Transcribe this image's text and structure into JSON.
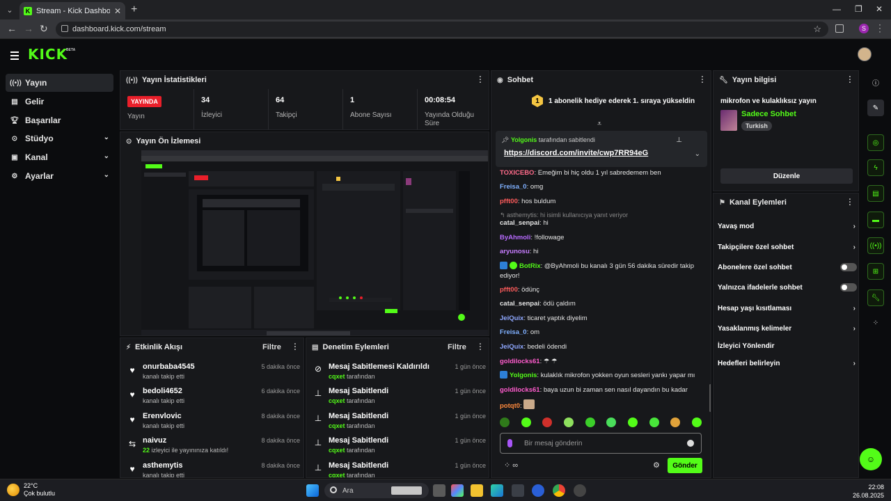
{
  "browser": {
    "tab_title": "Stream - Kick Dashboard",
    "url": "dashboard.kick.com/stream",
    "profile_initial": "S"
  },
  "brand": {
    "logo": "KICK",
    "beta": "BETA",
    "accent": "#53fc18"
  },
  "sidebar": {
    "items": [
      {
        "label": "Yayın",
        "icon": "broadcast-icon",
        "active": true
      },
      {
        "label": "Gelir",
        "icon": "revenue-icon"
      },
      {
        "label": "Başarılar",
        "icon": "trophy-icon"
      },
      {
        "label": "Stüdyo",
        "icon": "studio-icon",
        "expandable": true
      },
      {
        "label": "Kanal",
        "icon": "channel-icon",
        "expandable": true
      },
      {
        "label": "Ayarlar",
        "icon": "gear-icon",
        "expandable": true
      }
    ]
  },
  "stats": {
    "title": "Yayın İstatistikleri",
    "live_badge": "YAYINDA",
    "live_label": "Yayın",
    "items": [
      {
        "value": "34",
        "label": "İzleyici"
      },
      {
        "value": "64",
        "label": "Takipçi"
      },
      {
        "value": "1",
        "label": "Abone Sayısı"
      },
      {
        "value": "00:08:54",
        "label": "Yayında Olduğu Süre"
      }
    ]
  },
  "preview": {
    "title": "Yayın Ön İzlemesi"
  },
  "activity": {
    "title": "Etkinlik Akışı",
    "filter": "Filtre",
    "rows": [
      {
        "name": "onurbaba4545",
        "sub": "kanalı takip etti",
        "time": "5 dakika önce",
        "icon": "heart-icon"
      },
      {
        "name": "bedoli4652",
        "sub": "kanalı takip etti",
        "time": "6 dakika önce",
        "icon": "heart-icon"
      },
      {
        "name": "Erenvlovic",
        "sub": "kanalı takip etti",
        "time": "8 dakika önce",
        "icon": "heart-icon"
      },
      {
        "name": "naivuz",
        "sub_count": "22",
        "sub": "izleyici ile yayınınıza katıldı!",
        "time": "8 dakika önce",
        "icon": "raid-icon"
      },
      {
        "name": "asthemytis",
        "sub": "kanalı takip etti",
        "time": "8 dakika önce",
        "icon": "heart-icon"
      }
    ]
  },
  "moderation": {
    "title": "Denetim Eylemleri",
    "filter": "Filtre",
    "rows": [
      {
        "action": "Mesaj Sabitlemesi Kaldırıldı",
        "by": "cqxet",
        "by_suffix": "tarafından",
        "time": "1 gün önce",
        "icon": "unpin-icon"
      },
      {
        "action": "Mesaj Sabitlendi",
        "by": "cqxet",
        "by_suffix": "tarafından",
        "time": "1 gün önce",
        "icon": "pin-icon"
      },
      {
        "action": "Mesaj Sabitlendi",
        "by": "cqxet",
        "by_suffix": "tarafından",
        "time": "1 gün önce",
        "icon": "pin-icon"
      },
      {
        "action": "Mesaj Sabitlendi",
        "by": "cqxet",
        "by_suffix": "tarafından",
        "time": "1 gün önce",
        "icon": "pin-icon"
      },
      {
        "action": "Mesaj Sabitlendi",
        "by": "cqxet",
        "by_suffix": "tarafından",
        "time": "1 gün önce",
        "icon": "pin-icon"
      }
    ]
  },
  "chat": {
    "title": "Sohbet",
    "gift_rank": "1",
    "gift_text": "1 abonelik hediye ederek 1. sıraya yükseldin",
    "pinned": {
      "by": "Yolgonis",
      "by_suffix": "tarafından sabitlendi",
      "link": "https://discord.com/invite/cwp7RR94eG"
    },
    "messages": [
      {
        "user": "TOXICEBO",
        "color": "#ff6b8a",
        "text": "Emeğim bi hiç oldu 1 yıl sabredemem ben"
      },
      {
        "user": "Freisa_0",
        "color": "#7fb0ff",
        "text": "omg"
      },
      {
        "user": "pfft00",
        "color": "#ff5c5c",
        "text": "hos buldum"
      },
      {
        "reply": "asthemytis: hi isimli kullanıcıya yanıt veriyor"
      },
      {
        "user": "catal_senpai",
        "color": "#e6e6e6",
        "text": "hi"
      },
      {
        "user": "ByAhmoli",
        "color": "#b86bff",
        "text": "!followage"
      },
      {
        "user": "aryunosu",
        "color": "#c77dff",
        "text": "hi"
      },
      {
        "user": "BotRix",
        "color": "#53fc18",
        "text": "@ByAhmoli bu kanalı 3 gün 56 dakika süredir takip ediyor!",
        "badges": true
      },
      {
        "user": "pfft00",
        "color": "#ff5c5c",
        "text": "ödünç"
      },
      {
        "user": "catal_senpai",
        "color": "#e6e6e6",
        "text": "ödü çaldım"
      },
      {
        "user": "JeiQuix",
        "color": "#8fa8ff",
        "text": "ticaret yaptık diyelim"
      },
      {
        "user": "Freisa_0",
        "color": "#7fb0ff",
        "text": "om"
      },
      {
        "user": "JeiQuix",
        "color": "#8fa8ff",
        "text": "bedeli ödendi"
      },
      {
        "user": "goldilocks61",
        "color": "#ff5ccd",
        "text": "☂ ☂"
      },
      {
        "user": "Yolgonis",
        "color": "#53fc18",
        "text": "kulaklık mikrofon yokken oyun sesleri yankı yapar mı",
        "badges": true
      },
      {
        "user": "goldilocks61",
        "color": "#ff5ccd",
        "text": "baya uzun bi zaman sen nasıl dayandın bu kadar"
      },
      {
        "user": "potqt0",
        "color": "#ff8a3d",
        "text": ""
      }
    ],
    "input_placeholder": "Bir mesaj gönderin",
    "send_label": "Gönder"
  },
  "stream_info": {
    "title_header": "Yayın bilgisi",
    "stream_title": "mikrofon ve kulaklıksız yayın",
    "category": "Sadece Sohbet",
    "tag": "Turkish",
    "edit_label": "Düzenle"
  },
  "channel_actions": {
    "title": "Kanal Eylemleri",
    "rows": [
      {
        "label": "Yavaş mod",
        "type": "chevron"
      },
      {
        "label": "Takipçilere özel sohbet",
        "type": "chevron"
      },
      {
        "label": "Abonelere özel sohbet",
        "type": "toggle",
        "on": false
      },
      {
        "label": "Yalnızca ifadelerle sohbet",
        "type": "toggle",
        "on": false
      },
      {
        "label": "Hesap yaşı kısıtlaması",
        "type": "chevron"
      },
      {
        "label": "Yasaklanmış kelimeler",
        "type": "chevron"
      },
      {
        "label": "İzleyici Yönlendir",
        "type": "none"
      },
      {
        "label": "Hedefleri belirleyin",
        "type": "chevron"
      }
    ]
  },
  "taskbar": {
    "temp": "22°C",
    "weather": "Çok bulutlu",
    "search": "Ara",
    "time": "22:08",
    "date": "26.08.2025"
  }
}
